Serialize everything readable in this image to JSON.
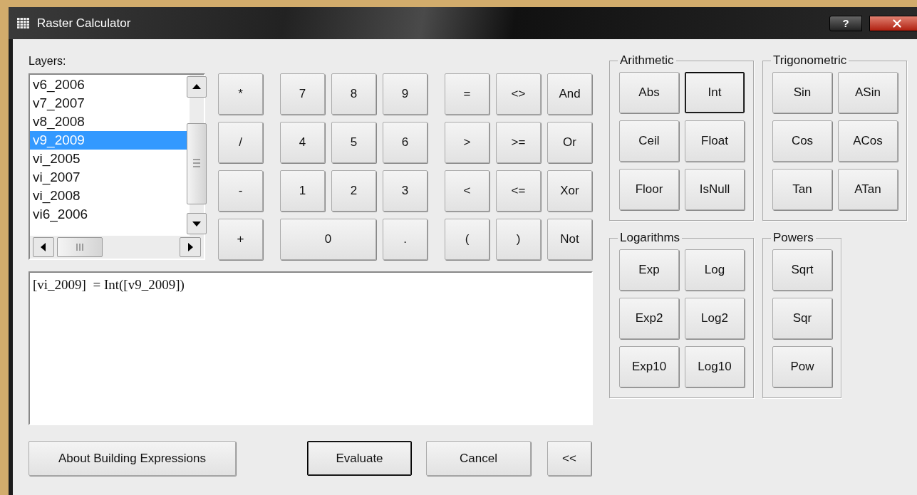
{
  "window": {
    "title": "Raster Calculator",
    "help": "?"
  },
  "layers": {
    "label": "Layers:",
    "items": [
      {
        "name": "v6_2006",
        "selected": false
      },
      {
        "name": "v7_2007",
        "selected": false
      },
      {
        "name": "v8_2008",
        "selected": false
      },
      {
        "name": "v9_2009",
        "selected": true
      },
      {
        "name": "vi_2005",
        "selected": false
      },
      {
        "name": "vi_2007",
        "selected": false
      },
      {
        "name": "vi_2008",
        "selected": false
      },
      {
        "name": "vi6_2006",
        "selected": false
      }
    ]
  },
  "keypad": {
    "operators": [
      "*",
      "/",
      "-",
      "+"
    ],
    "digits": [
      {
        "label": "7",
        "kind": "key"
      },
      {
        "label": "8",
        "kind": "key"
      },
      {
        "label": "9",
        "kind": "key"
      },
      {
        "label": "4",
        "kind": "key"
      },
      {
        "label": "5",
        "kind": "key"
      },
      {
        "label": "6",
        "kind": "key"
      },
      {
        "label": "1",
        "kind": "key"
      },
      {
        "label": "2",
        "kind": "key"
      },
      {
        "label": "3",
        "kind": "key"
      },
      {
        "label": "0",
        "kind": "wide"
      },
      {
        "label": ".",
        "kind": "key"
      }
    ],
    "logic": [
      "=",
      "<>",
      "And",
      ">",
      ">=",
      "Or",
      "<",
      "<=",
      "Xor",
      "(",
      ")",
      "Not"
    ]
  },
  "groups": [
    {
      "title": "Arithmetic",
      "buttons": [
        {
          "label": "Abs",
          "focused": false
        },
        {
          "label": "Int",
          "focused": true
        },
        {
          "label": "Ceil",
          "focused": false
        },
        {
          "label": "Float",
          "focused": false
        },
        {
          "label": "Floor",
          "focused": false
        },
        {
          "label": "IsNull",
          "focused": false
        }
      ]
    },
    {
      "title": "Trigonometric",
      "buttons": [
        {
          "label": "Sin",
          "focused": false
        },
        {
          "label": "ASin",
          "focused": false
        },
        {
          "label": "Cos",
          "focused": false
        },
        {
          "label": "ACos",
          "focused": false
        },
        {
          "label": "Tan",
          "focused": false
        },
        {
          "label": "ATan",
          "focused": false
        }
      ]
    },
    {
      "title": "Logarithms",
      "buttons": [
        {
          "label": "Exp",
          "focused": false
        },
        {
          "label": "Log",
          "focused": false
        },
        {
          "label": "Exp2",
          "focused": false
        },
        {
          "label": "Log2",
          "focused": false
        },
        {
          "label": "Exp10",
          "focused": false
        },
        {
          "label": "Log10",
          "focused": false
        }
      ]
    },
    {
      "title": "Powers",
      "buttons": [
        {
          "label": "Sqrt",
          "focused": false
        },
        {
          "label": "Sqr",
          "focused": false
        },
        {
          "label": "Pow",
          "focused": false
        }
      ]
    }
  ],
  "expression": "[vi_2009]  = Int([v9_2009])",
  "buttons": [
    {
      "label": "About Building Expressions",
      "default": false
    },
    {
      "label": "Evaluate",
      "default": true
    },
    {
      "label": "Cancel",
      "default": false
    },
    {
      "label": "<<",
      "default": false
    }
  ]
}
